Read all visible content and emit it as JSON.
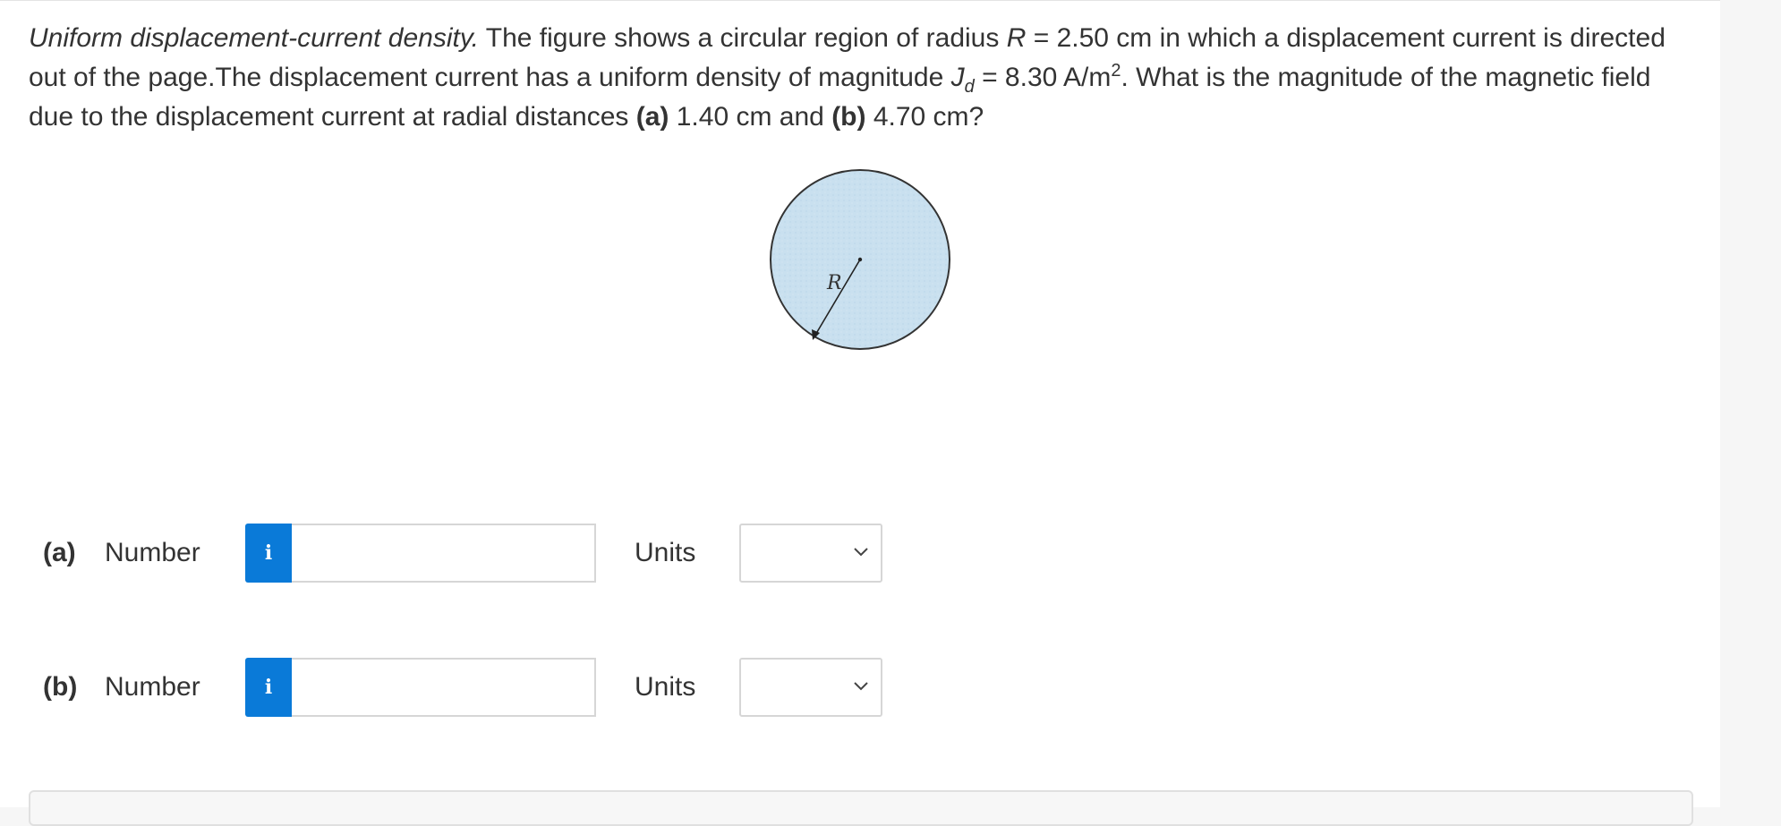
{
  "question": {
    "title": "Uniform displacement-current density.",
    "text1": " The figure shows a circular region of radius ",
    "r_symbol": "R",
    "text2": " = 2.50 cm in which a displacement current is directed out of the page.The displacement current has a uniform density of magnitude ",
    "j_symbol": "J",
    "j_subscript": "d",
    "text3": " = 8.30 A/m",
    "exponent": "2",
    "text4": ". What is the magnitude of the magnetic field due to the displacement current at radial distances ",
    "part_a_tag": "(a)",
    "text5": " 1.40 cm and ",
    "part_b_tag": "(b)",
    "text6": " 4.70 cm?"
  },
  "figure": {
    "radius_label": "R",
    "fill_color": "#c9e0ef",
    "stroke_color": "#333333"
  },
  "parts": [
    {
      "label": "(a)",
      "number_label": "Number",
      "info_icon": "i",
      "number_value": "",
      "units_label": "Units",
      "units_value": ""
    },
    {
      "label": "(b)",
      "number_label": "Number",
      "info_icon": "i",
      "number_value": "",
      "units_label": "Units",
      "units_value": ""
    }
  ],
  "colors": {
    "accent": "#0a7ad8",
    "input_border": "#d6d6d6",
    "text": "#333333"
  }
}
